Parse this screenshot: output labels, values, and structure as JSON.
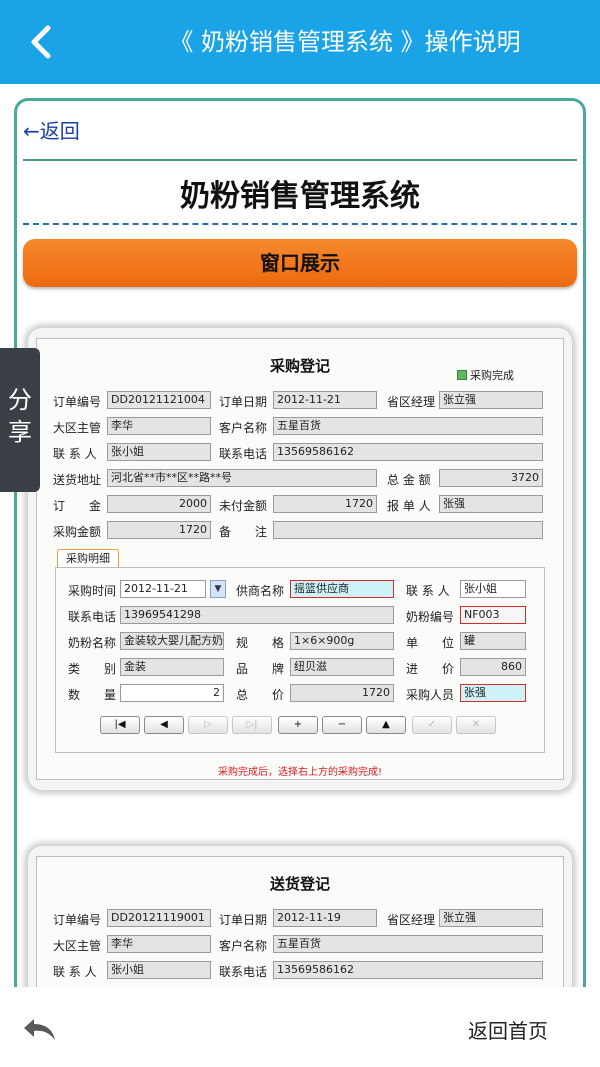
{
  "header": {
    "title": "《 奶粉销售管理系统 》操作说明",
    "back_icon": "chevron-left-icon"
  },
  "content": {
    "back_link": "←返回",
    "system_title": "奶粉销售管理系统",
    "section_title": "窗口展示",
    "share_label": "分享"
  },
  "purchase_form": {
    "title": "采购登记",
    "complete_checkbox": "采购完成",
    "labels": {
      "order_no": "订单编号",
      "order_date": "订单日期",
      "province_manager": "省区经理",
      "region_manager": "大区主管",
      "customer_name": "客户名称",
      "contact": "联 系 人",
      "contact_phone": "联系电话",
      "address": "送货地址",
      "total": "总 金 额",
      "deposit": "订　　金",
      "unpaid": "未付金额",
      "reporter": "报 单 人",
      "purchase_amount": "采购金额",
      "remark": "备　　注"
    },
    "values": {
      "order_no": "DD20121121004",
      "order_date": "2012-11-21",
      "province_manager": "张立强",
      "region_manager": "李华",
      "customer_name": "五星百货",
      "contact": "张小姐",
      "contact_phone": "13569586162",
      "address": "河北省**市**区**路**号",
      "total": "3720",
      "deposit": "2000",
      "unpaid": "1720",
      "reporter": "张强",
      "purchase_amount": "1720",
      "remark": ""
    },
    "detail_tab": "采购明细",
    "detail_labels": {
      "purchase_time": "采购时间",
      "supplier": "供商名称",
      "contact": "联 系 人",
      "phone": "联系电话",
      "milk_no": "奶粉编号",
      "milk_name": "奶粉名称",
      "spec": "规　　格",
      "unit": "单　　位",
      "category": "类　　别",
      "brand": "品　　牌",
      "price_in": "进　　价",
      "quantity": "数　　量",
      "total_price": "总　　价",
      "buyer": "采购人员"
    },
    "detail_values": {
      "purchase_time": "2012-11-21",
      "supplier": "摇篮供应商",
      "contact": "张小姐",
      "phone": "13969541298",
      "milk_no": "NF003",
      "milk_name": "金装较大婴儿配方奶",
      "spec": "1×6×900g",
      "unit": "罐",
      "category": "金装",
      "brand": "纽贝滋",
      "price_in": "860",
      "quantity": "2",
      "total_price": "1720",
      "buyer": "张强"
    },
    "nav_buttons": [
      "|◀",
      "◀",
      "▷",
      "▷|",
      "+",
      "−",
      "▲",
      "✓",
      "✕"
    ],
    "hint": "采购完成后，选择右上方的采购完成!"
  },
  "delivery_form": {
    "title": "送货登记",
    "labels": {
      "order_no": "订单编号",
      "order_date": "订单日期",
      "province_manager": "省区经理",
      "region_manager": "大区主管",
      "customer_name": "客户名称",
      "contact": "联 系 人",
      "contact_phone": "联系电话"
    },
    "values": {
      "order_no": "DD20121119001",
      "order_date": "2012-11-19",
      "province_manager": "张立强",
      "region_manager": "李华",
      "customer_name": "五星百货",
      "contact": "张小姐",
      "contact_phone": "13569586162"
    }
  },
  "footer": {
    "undo_icon": "undo-arrow-icon",
    "home_link": "返回首页"
  },
  "colors": {
    "header_bg": "#1aa3e6",
    "section_orange": "#f27a1e",
    "frame_teal": "#4aa89a",
    "share_bg": "#3a3f46"
  }
}
